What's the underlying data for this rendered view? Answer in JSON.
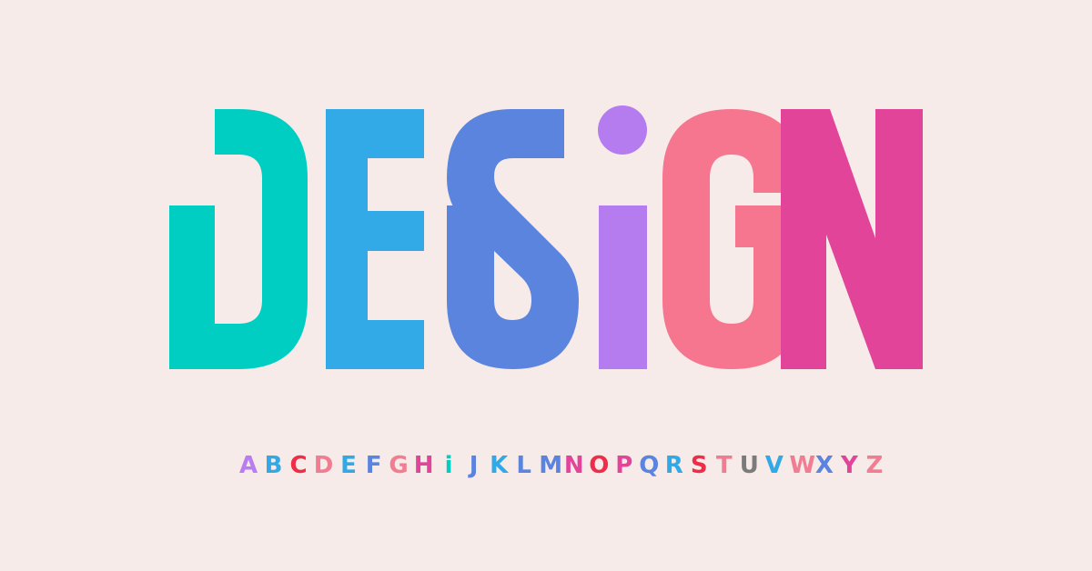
{
  "heading": {
    "word": "DESIGN",
    "letters": [
      {
        "char": "D",
        "color": "#00cec3"
      },
      {
        "char": "E",
        "color": "#31aae7"
      },
      {
        "char": "S",
        "color": "#5b84de"
      },
      {
        "char": "i",
        "color": "#b57cf0"
      },
      {
        "char": "G",
        "color": "#f5768e"
      },
      {
        "char": "N",
        "color": "#e2449a"
      }
    ]
  },
  "alphabet": {
    "text": "A B C D E F G H I J K L M N O P Q R S T U V W X Y Z",
    "letters": [
      {
        "char": "A",
        "color": "#b77df1"
      },
      {
        "char": "B",
        "color": "#31a9e7"
      },
      {
        "char": "C",
        "color": "#ee2d49"
      },
      {
        "char": "D",
        "color": "#f07d91"
      },
      {
        "char": "E",
        "color": "#31a9e7"
      },
      {
        "char": "F",
        "color": "#5b84de"
      },
      {
        "char": "G",
        "color": "#f07d91"
      },
      {
        "char": "H",
        "color": "#e2449a"
      },
      {
        "char": "i",
        "color": "#00cec3"
      },
      {
        "char": "J",
        "color": "#5b84de"
      },
      {
        "char": "K",
        "color": "#31a9e7"
      },
      {
        "char": "L",
        "color": "#5b84de"
      },
      {
        "char": "M",
        "color": "#5b84de"
      },
      {
        "char": "N",
        "color": "#e2449a"
      },
      {
        "char": "O",
        "color": "#ee2d49"
      },
      {
        "char": "P",
        "color": "#e2449a"
      },
      {
        "char": "Q",
        "color": "#5b84de"
      },
      {
        "char": "R",
        "color": "#31a9e7"
      },
      {
        "char": "S",
        "color": "#ee2d49"
      },
      {
        "char": "T",
        "color": "#f07d91"
      },
      {
        "char": "U",
        "color": "#7b7b7b"
      },
      {
        "char": "V",
        "color": "#31a9e7"
      },
      {
        "char": "W",
        "color": "#f07d91"
      },
      {
        "char": "X",
        "color": "#5b84de"
      },
      {
        "char": "Y",
        "color": "#e2449a"
      },
      {
        "char": "Z",
        "color": "#f07d91"
      }
    ]
  },
  "background_color": "#f6ebe8"
}
